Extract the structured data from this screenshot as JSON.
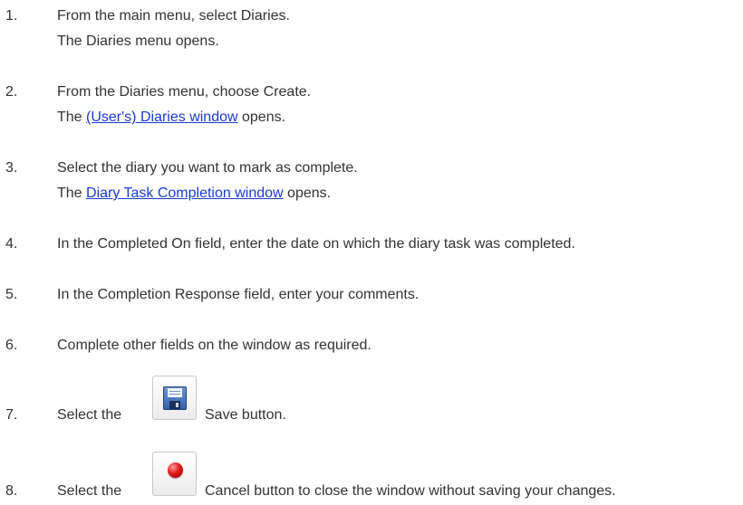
{
  "steps": [
    {
      "num": "1.",
      "text": "From the main menu, select Diaries.",
      "result": "The Diaries menu opens."
    },
    {
      "num": "2.",
      "text": "From the Diaries menu, choose Create.",
      "result_prefix": "The ",
      "result_link": "(User's) Diaries window",
      "result_suffix": " opens."
    },
    {
      "num": "3.",
      "text": "Select the diary you want to mark as complete.",
      "result_prefix": "The ",
      "result_link": "Diary Task Completion window",
      "result_suffix": " opens."
    },
    {
      "num": "4.",
      "text": "In the Completed On field, enter the date on which the diary task was completed."
    },
    {
      "num": "5.",
      "text": "In the Completion Response field, enter your comments."
    },
    {
      "num": "6.",
      "text": "Complete other fields on the window as required."
    },
    {
      "num": "7.",
      "prefix": "Select the",
      "suffix": "Save button.",
      "icon": "save-floppy-icon"
    },
    {
      "num": "8.",
      "prefix": "Select the",
      "suffix": "Cancel button to close the window without saving your changes.",
      "icon": "cancel-red-dot-icon"
    }
  ],
  "colors": {
    "text": "#333333",
    "link": "#1a3bd6"
  }
}
